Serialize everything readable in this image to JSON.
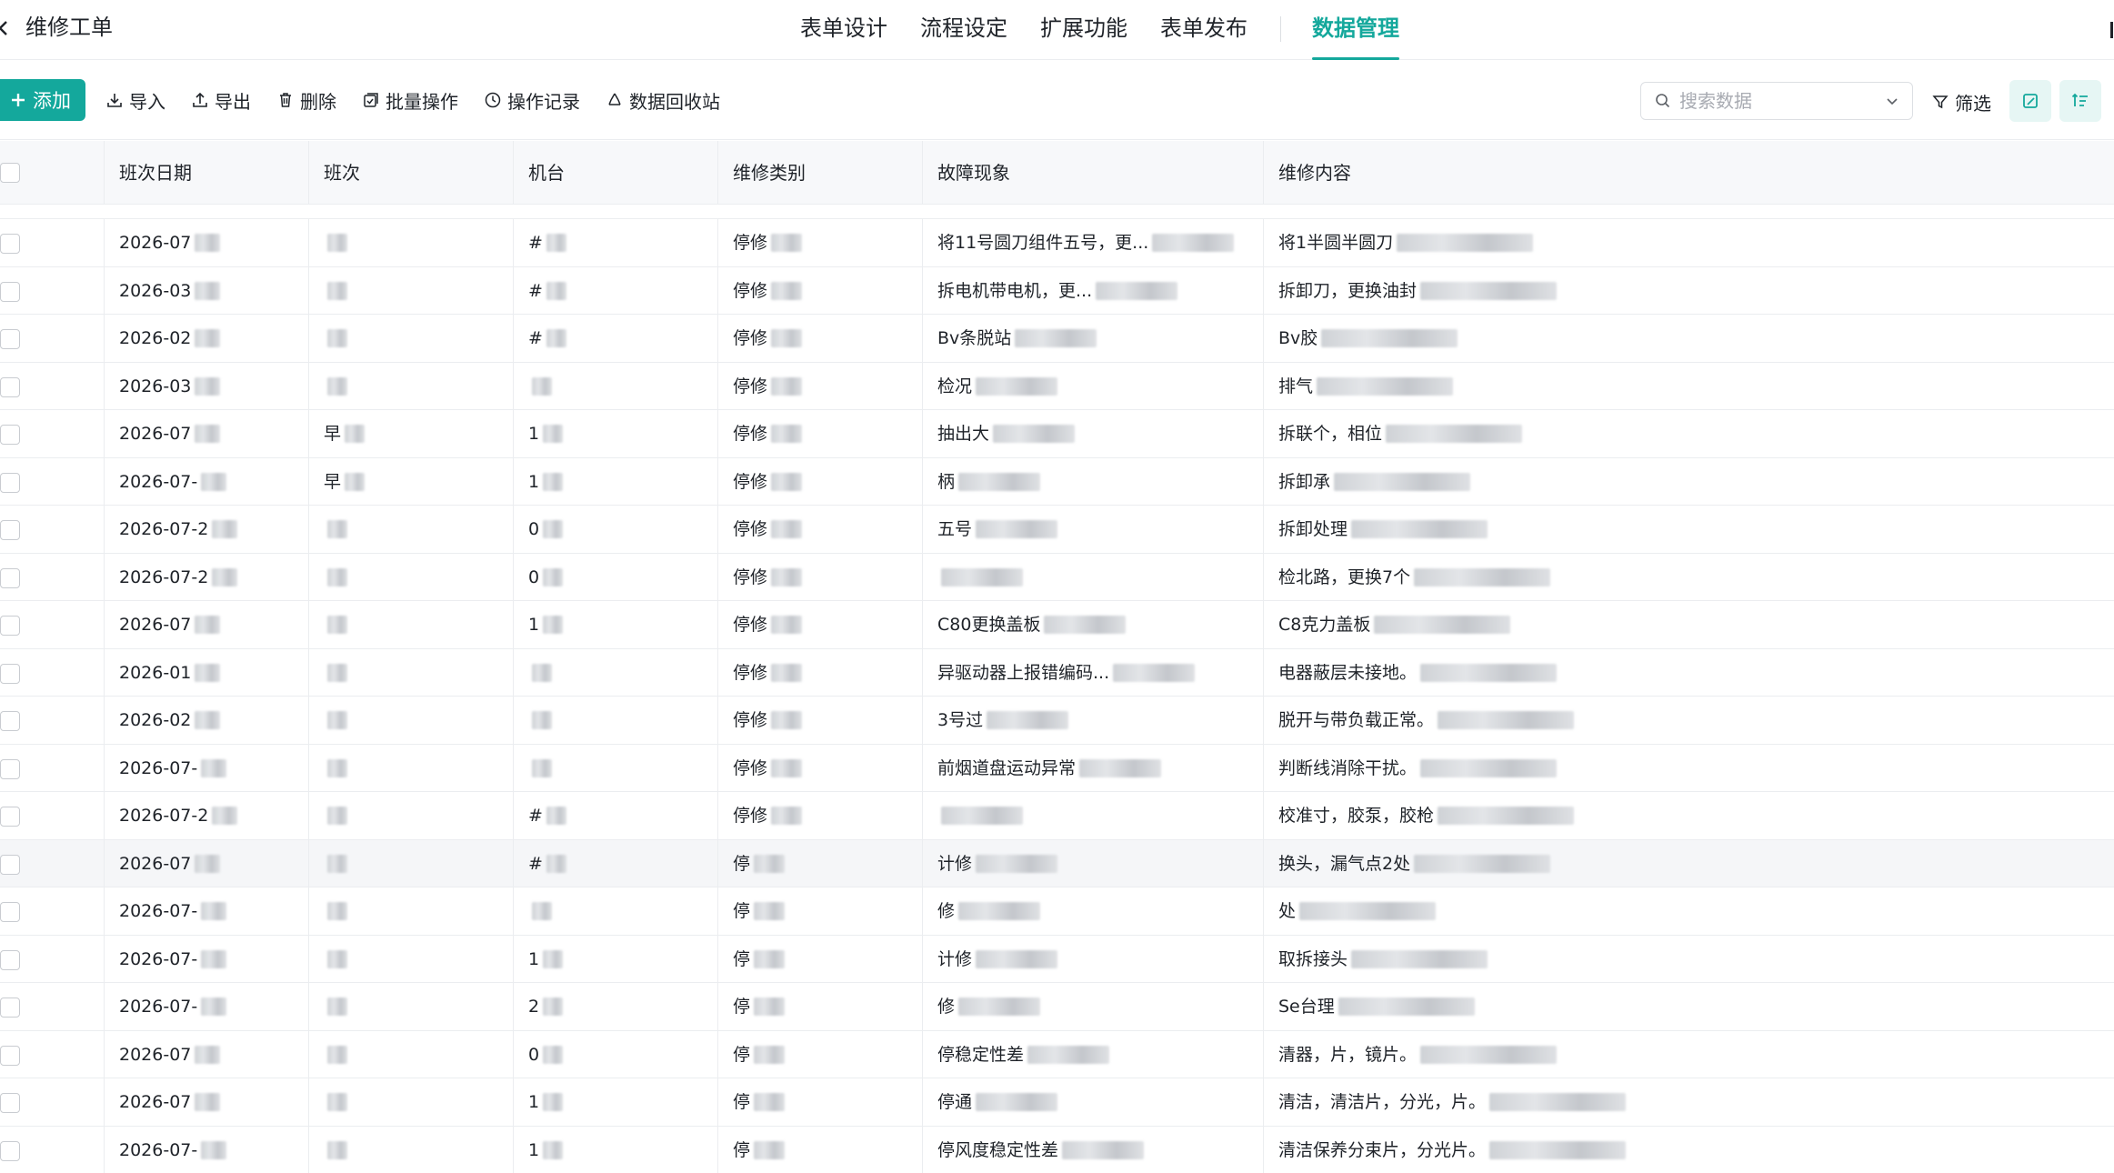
{
  "app": {
    "title": "维修工单"
  },
  "nav": {
    "tabs": [
      {
        "label": "表单设计"
      },
      {
        "label": "流程设定"
      },
      {
        "label": "扩展功能"
      },
      {
        "label": "表单发布"
      },
      {
        "label": "数据管理",
        "active": true
      }
    ]
  },
  "toolbar": {
    "add_label": "添加",
    "import_label": "导入",
    "export_label": "导出",
    "delete_label": "删除",
    "batch_label": "批量操作",
    "log_label": "操作记录",
    "recycle_label": "数据回收站",
    "search_placeholder": "搜索数据",
    "filter_label": "筛选"
  },
  "table": {
    "columns": [
      "班次日期",
      "班次",
      "机台",
      "维修类别",
      "故障现象",
      "维修内容"
    ],
    "rows": [
      {
        "date": "2026-07",
        "shift": "",
        "machine": "#",
        "category": "停修",
        "fault": "将11号圆刀组件五号，更...",
        "content": "将1半圆半圆刀"
      },
      {
        "date": "2026-03",
        "shift": "",
        "machine": "#",
        "category": "停修",
        "fault": "拆电机带电机，更...",
        "content": "拆卸刀，更换油封"
      },
      {
        "date": "2026-02",
        "shift": "",
        "machine": "#",
        "category": "停修",
        "fault": "Bv条脱站",
        "content": "Bv胶"
      },
      {
        "date": "2026-03",
        "shift": "",
        "machine": "",
        "category": "停修",
        "fault": "检况",
        "content": "排气"
      },
      {
        "date": "2026-07",
        "shift": "早",
        "machine": "1",
        "category": "停修",
        "fault": "抽出大",
        "content": "拆联个，相位"
      },
      {
        "date": "2026-07-",
        "shift": "早",
        "machine": "1",
        "category": "停修",
        "fault": "柄",
        "content": "拆卸承"
      },
      {
        "date": "2026-07-2",
        "shift": "",
        "machine": "0",
        "category": "停修",
        "fault": "五号",
        "content": "拆卸处理"
      },
      {
        "date": "2026-07-2",
        "shift": "",
        "machine": "0",
        "category": "停修",
        "fault": "",
        "content": "检北路，更换7个"
      },
      {
        "date": "2026-07",
        "shift": "",
        "machine": "1",
        "category": "停修",
        "fault": "C80更换盖板",
        "content": "C8克力盖板"
      },
      {
        "date": "2026-01",
        "shift": "",
        "machine": "",
        "category": "停修",
        "fault": "异驱动器上报错编码...",
        "content": "电器蔽层未接地。"
      },
      {
        "date": "2026-02",
        "shift": "",
        "machine": "",
        "category": "停修",
        "fault": "3号过",
        "content": "脱开与带负载正常。"
      },
      {
        "date": "2026-07-",
        "shift": "",
        "machine": "",
        "category": "停修",
        "fault": "前烟道盘运动异常",
        "content": "判断线消除干扰。"
      },
      {
        "date": "2026-07-2",
        "shift": "",
        "machine": "#",
        "category": "停修",
        "fault": "",
        "content": "校准寸，胶泵，胶枪"
      },
      {
        "date": "2026-07",
        "shift": "",
        "machine": "#",
        "category": "停",
        "fault": "计修",
        "content": "换头，漏气点2处"
      },
      {
        "date": "2026-07-",
        "shift": "",
        "machine": "",
        "category": "停",
        "fault": "修",
        "content": "处"
      },
      {
        "date": "2026-07-",
        "shift": "",
        "machine": "1",
        "category": "停",
        "fault": "计修",
        "content": "取拆接头"
      },
      {
        "date": "2026-07-",
        "shift": "",
        "machine": "2",
        "category": "停",
        "fault": "修",
        "content": "Se台理"
      },
      {
        "date": "2026-07",
        "shift": "",
        "machine": "0",
        "category": "停",
        "fault": "停稳定性差",
        "content": "清器，片，镜片。"
      },
      {
        "date": "2026-07",
        "shift": "",
        "machine": "1",
        "category": "停",
        "fault": "停通",
        "content": "清洁，清洁片，分光，片。"
      },
      {
        "date": "2026-07-",
        "shift": "",
        "machine": "1",
        "category": "停",
        "fault": "停风度稳定性差",
        "content": "清洁保养分束片，分光片。"
      }
    ]
  },
  "colors": {
    "accent": "#14a89c",
    "header_bg": "#f7f8fa",
    "border": "#ebedf0"
  }
}
